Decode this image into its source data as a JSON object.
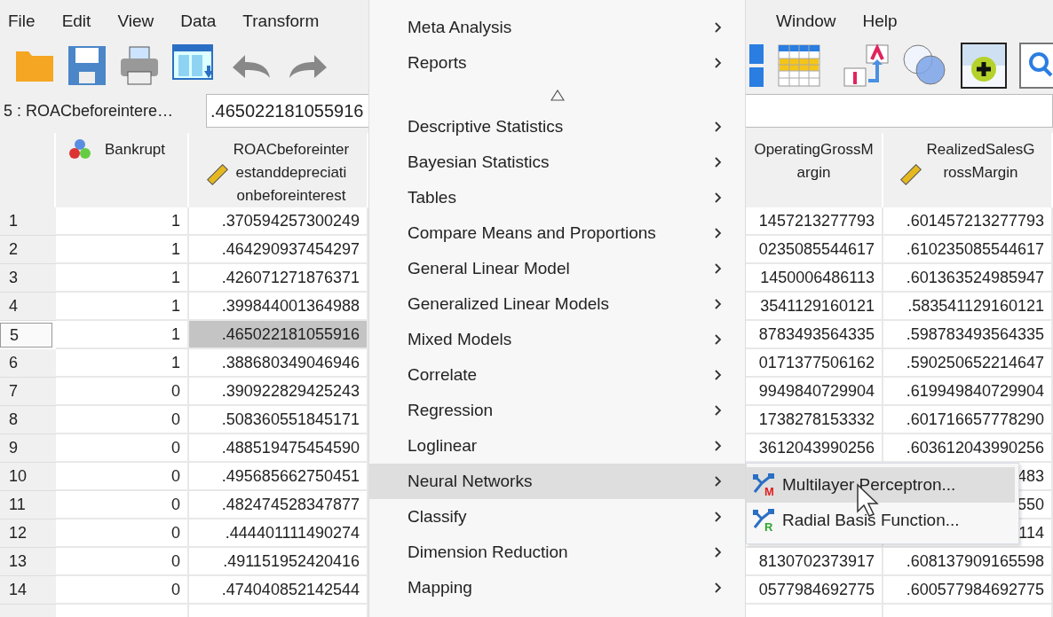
{
  "menubar": {
    "left": [
      {
        "label": "File"
      },
      {
        "label": "Edit"
      },
      {
        "label": "View"
      },
      {
        "label": "Data"
      },
      {
        "label": "Transform"
      }
    ],
    "right": [
      {
        "label": "Window"
      },
      {
        "label": "Help"
      }
    ]
  },
  "cell_editor": {
    "name": "5 : ROACbeforeintere…",
    "value": ".465022181055916"
  },
  "table": {
    "columns": [
      {
        "name": "Bankrupt",
        "kind": "nominal"
      },
      {
        "name": "ROACbeforeinterestanddepreciationbeforeinterest",
        "kind": "scale"
      },
      {
        "name": "OperatingGrossMargin"
      },
      {
        "name": "RealizedSalesGrossMargin",
        "kind": "scale"
      }
    ],
    "rows": [
      {
        "number": "1",
        "selected": false,
        "cells": [
          "1",
          ".370594257300249",
          "1457213277793",
          ".601457213277793"
        ]
      },
      {
        "number": "2",
        "selected": false,
        "cells": [
          "1",
          ".464290937454297",
          "0235085544617",
          ".610235085544617"
        ]
      },
      {
        "number": "3",
        "selected": false,
        "cells": [
          "1",
          ".426071271876371",
          "1450006486113",
          ".601363524985947"
        ]
      },
      {
        "number": "4",
        "selected": false,
        "cells": [
          "1",
          ".399844001364988",
          "3541129160121",
          ".583541129160121"
        ]
      },
      {
        "number": "5",
        "selected": true,
        "cells": [
          "1",
          ".465022181055916",
          "8783493564335",
          ".598783493564335"
        ]
      },
      {
        "number": "6",
        "selected": false,
        "cells": [
          "1",
          ".388680349046946",
          "0171377506162",
          ".590250652214647"
        ]
      },
      {
        "number": "7",
        "selected": false,
        "cells": [
          "0",
          ".390922829425243",
          "9949840729904",
          ".619949840729904"
        ]
      },
      {
        "number": "8",
        "selected": false,
        "cells": [
          "0",
          ".508360551845171",
          "1738278153332",
          ".601716657778290"
        ]
      },
      {
        "number": "9",
        "selected": false,
        "cells": [
          "0",
          ".488519475454590",
          "3612043990256",
          ".603612043990256"
        ]
      },
      {
        "number": "10",
        "selected": false,
        "cells": [
          "0",
          ".495685662750451",
          null,
          "483"
        ]
      },
      {
        "number": "11",
        "selected": false,
        "cells": [
          "0",
          ".482474528347877",
          null,
          "550"
        ]
      },
      {
        "number": "12",
        "selected": false,
        "cells": [
          "0",
          ".444401111490274",
          null,
          "114"
        ]
      },
      {
        "number": "13",
        "selected": false,
        "cells": [
          "0",
          ".491151952420416",
          "8130702373917",
          ".608137909165598"
        ]
      },
      {
        "number": "14",
        "selected": false,
        "cells": [
          "0",
          ".474040852142544",
          "0577984692775",
          ".600577984692775"
        ]
      }
    ]
  },
  "analyze_menu": {
    "items": [
      {
        "label": "Meta Analysis",
        "selected": false
      },
      {
        "label": "Reports",
        "selected": false
      },
      {
        "kind": "scroll_up"
      },
      {
        "label": "Descriptive Statistics",
        "selected": false
      },
      {
        "label": "Bayesian Statistics",
        "selected": false
      },
      {
        "label": "Tables",
        "selected": false
      },
      {
        "label": "Compare Means and Proportions",
        "selected": false
      },
      {
        "label": "General Linear Model",
        "selected": false
      },
      {
        "label": "Generalized Linear Models",
        "selected": false
      },
      {
        "label": "Mixed Models",
        "selected": false
      },
      {
        "label": "Correlate",
        "selected": false
      },
      {
        "label": "Regression",
        "selected": false
      },
      {
        "label": "Loglinear",
        "selected": false
      },
      {
        "label": "Neural Networks",
        "selected": true
      },
      {
        "label": "Classify",
        "selected": false
      },
      {
        "label": "Dimension Reduction",
        "selected": false
      },
      {
        "label": "Mapping",
        "selected": false
      }
    ]
  },
  "submenu": {
    "items": [
      {
        "label": "Multilayer Perceptron...",
        "letter": "M",
        "selected": true
      },
      {
        "label": "Radial Basis Function...",
        "letter": "R",
        "selected": false
      }
    ]
  }
}
